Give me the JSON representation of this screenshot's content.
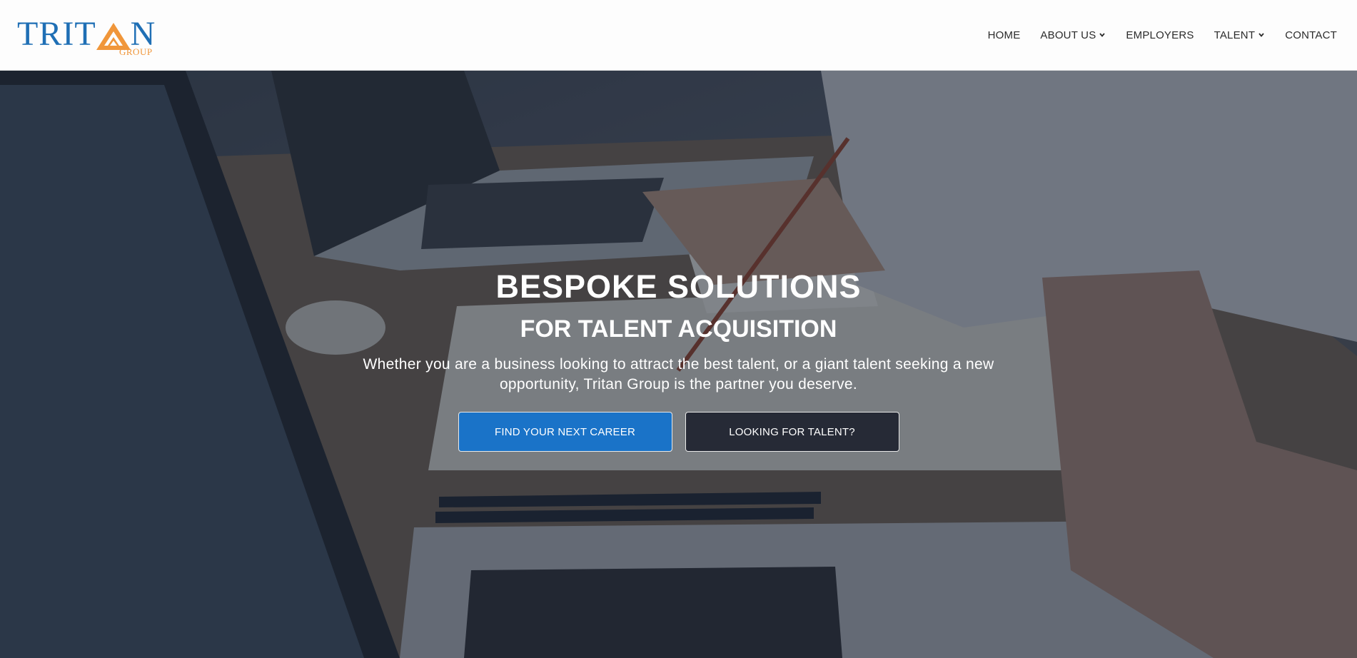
{
  "brand": {
    "name": "TRITAN",
    "name_left": "TRIT",
    "name_right": "N",
    "sub": "GROUP",
    "primary_color": "#1f6fb5",
    "accent_color": "#f0963a"
  },
  "nav": {
    "items": [
      {
        "label": "HOME",
        "dropdown": false
      },
      {
        "label": "ABOUT US",
        "dropdown": true
      },
      {
        "label": "EMPLOYERS",
        "dropdown": false
      },
      {
        "label": "TALENT",
        "dropdown": true
      },
      {
        "label": "CONTACT",
        "dropdown": false
      }
    ],
    "chevron_icon": "chevron-down-icon"
  },
  "hero": {
    "title": "BESPOKE SOLUTIONS",
    "subtitle": "FOR TALENT ACQUISITION",
    "text": "Whether you are a business looking to attract the best talent, or a giant talent seeking a new opportunity, Tritan Group is the partner you deserve.",
    "buttons": {
      "primary_label": "FIND YOUR NEXT CAREER",
      "secondary_label": "LOOKING FOR TALENT?"
    },
    "primary_button_color": "#1a73c8",
    "secondary_button_color": "#262a36"
  }
}
